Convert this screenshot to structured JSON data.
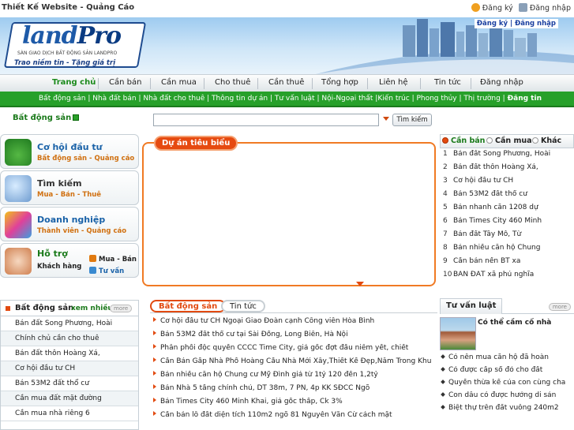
{
  "site": {
    "title": "Thiết Kế Website - Quảng Cáo",
    "register": "Đăng ký",
    "login": "Đăng nhập"
  },
  "header": {
    "logo_main": "land",
    "logo_accent": "Pro",
    "logo_sub": "SÀN GIAO DỊCH BẤT ĐỘNG SẢN LANDPRO",
    "slogan": "Trao niềm tin - Tặng giá trị",
    "auth_register": "Đăng ký",
    "auth_sep": " | ",
    "auth_login": "Đăng nhập"
  },
  "nav": {
    "items": [
      "Trang chủ",
      "Cần bán",
      "Cần mua",
      "Cho thuê",
      "Cần thuê",
      "Tổng hợp",
      "Liên hệ",
      "Tin tức",
      "Đăng nhập"
    ]
  },
  "subnav": {
    "items": "Bất động sản | Nhà đất bán | Nhà đất cho thuê | Thông tin dự án | Tư vấn luật | Nội-Ngoại thất |Kiến trúc | Phong thủy | Thị trường | ",
    "selected": "Đăng tin"
  },
  "search": {
    "category": "Bất động sản",
    "value": "",
    "button": "Tìm kiếm"
  },
  "left_boxes": [
    {
      "title": "Cơ hội đầu tư",
      "subtitle": "Bất động sản - Quảng cáo",
      "icon": "house-money-icon",
      "color": "#2a8a2a"
    },
    {
      "title": "Tìm kiếm",
      "subtitle": "Mua - Bán - Thuê",
      "icon": "magnifier-icon",
      "color": "#4a7ab8"
    },
    {
      "title": "Doanh nghiệp",
      "subtitle": "Thành viên - Quảng cáo",
      "icon": "cubes-icon",
      "color": "#d03ab0"
    },
    {
      "title": "Hỗ trợ",
      "subtitle": "Khách hàng",
      "right1": "Mua - Bán",
      "right2": "Tư vấn",
      "icon": "support-icon",
      "color": "#d05010"
    }
  ],
  "feature": {
    "tab": "Dự án tiêu biểu"
  },
  "right_panel": {
    "tabs": [
      "Cần bán",
      "Cần mua",
      "Khác"
    ],
    "items": [
      {
        "n": "1",
        "text": "Bán đất Song Phương, Hoài"
      },
      {
        "n": "2",
        "text": "Bán đất thôn Hoàng Xá,"
      },
      {
        "n": "3",
        "text": "Cơ hội đầu tư CH"
      },
      {
        "n": "4",
        "text": "Bán 53M2 đất thổ cư"
      },
      {
        "n": "5",
        "text": "Bán nhanh căn 1208 dự"
      },
      {
        "n": "6",
        "text": "Bán Times City 460 Minh"
      },
      {
        "n": "7",
        "text": "Bán đất Tây Mỗ, Từ"
      },
      {
        "n": "8",
        "text": "Bán nhiều căn hộ Chung"
      },
      {
        "n": "9",
        "text": "Cần bán nền BT xa"
      },
      {
        "n": "10",
        "text": "BÁN ĐẤT xã phú nghĩa"
      }
    ]
  },
  "lower_left": {
    "title": "Bất động sản",
    "more_link": "xem nhiều",
    "more_btn": "more",
    "items": [
      "Bán đất Song Phương, Hoài",
      "Chính chủ cần cho thuê",
      "Bán đất thôn Hoàng Xá,",
      "Cơ hội đầu tư CH",
      "Bán 53M2 đất thổ cư",
      "Cần mua đất mặt đường",
      "Cần mua nhà riêng 6"
    ]
  },
  "mid": {
    "tabs": [
      "Bất động sản",
      "Tin tức"
    ],
    "items": [
      "Cơ hội đầu tư CH Ngoại Giao Đoàn cạnh Công viên Hòa Bình",
      "Bán 53M2 đất thổ cư tại Sài Đồng, Long Biên, Hà Nội",
      "Phân phối độc quyền CCCC Time City, giá gốc đợt đầu niêm yết, chiết",
      "Cần Bán Gấp Nhà Phố Hoàng Cầu Nhà Mới Xây,Thiết Kế Đẹp,Nằm Trong Khu",
      "Bán nhiều căn hộ Chung cư Mỹ Đình giá từ 1tỷ 120 đến 1,2tỷ",
      "Bán Nhà 5 tầng chính chủ, DT 38m, 7 PN, 4p KK SĐCC Ngõ",
      "Bán Times City 460 Minh Khai, giá gốc thấp, Ck 3%",
      "Cần bán lô đất diện tích 110m2 ngõ 81 Nguyễn Văn Cừ cách mặt"
    ]
  },
  "consult": {
    "tab": "Tư vấn luật",
    "more": "more",
    "featured": "Có thể cầm cố nhà",
    "items": [
      "Có nên mua căn hộ đã hoàn",
      "Có được cấp sổ đỏ cho đất",
      "Quyền thừa kế của con cùng cha",
      "Con dâu có được hưởng di sản",
      "Biệt thự trên đất vuông 240m2"
    ]
  }
}
